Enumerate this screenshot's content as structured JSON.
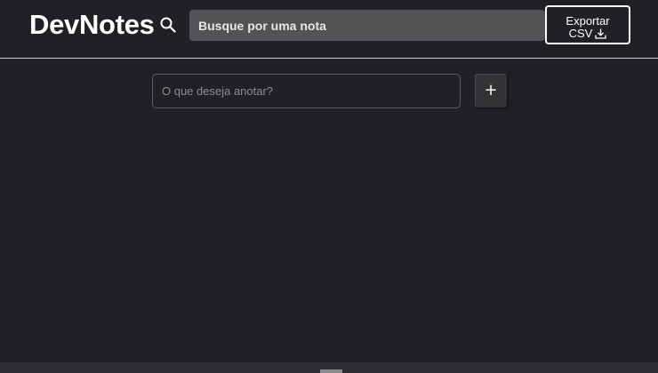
{
  "header": {
    "logo": "DevNotes",
    "search": {
      "placeholder": "Busque por uma nota",
      "icon": "search-icon"
    },
    "export_button": {
      "line1": "Exportar",
      "line2": "CSV",
      "icon": "download-icon"
    }
  },
  "note_form": {
    "input_placeholder": "O que deseja anotar?",
    "add_button_label": "+"
  },
  "colors": {
    "background": "#202124",
    "search_bg": "#525355",
    "divider": "#c8c8c8"
  }
}
